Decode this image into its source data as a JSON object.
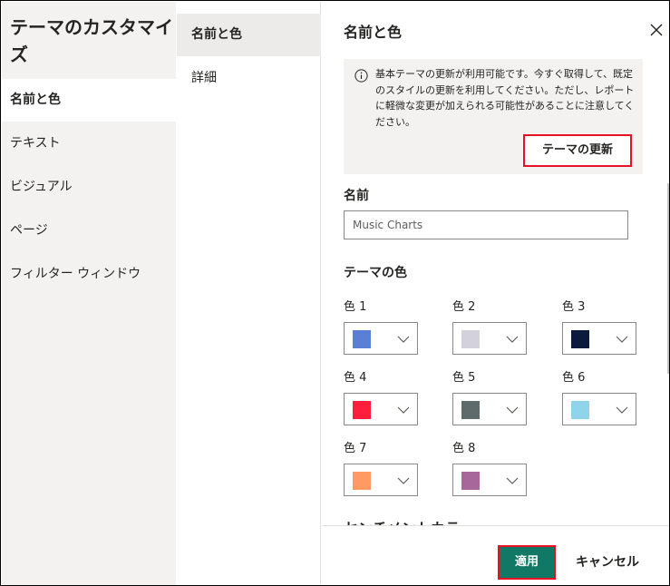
{
  "left_nav": {
    "title": "テーマのカスタマイズ",
    "items": [
      {
        "label": "名前と色"
      },
      {
        "label": "テキスト"
      },
      {
        "label": "ビジュアル"
      },
      {
        "label": "ページ"
      },
      {
        "label": "フィルター ウィンドウ"
      }
    ]
  },
  "sub_nav": {
    "items": [
      {
        "label": "名前と色"
      },
      {
        "label": "詳細"
      }
    ]
  },
  "main": {
    "section_title": "名前と色",
    "notice": {
      "icon": "info-icon",
      "message": "基本テーマの更新が利用可能です。今すぐ取得して、既定のスタイルの更新を利用してください。ただし、レポートに軽微な変更が加えられる可能性があることに注意してください。",
      "update_button": "テーマの更新"
    },
    "name_label": "名前",
    "name_value": "Music Charts",
    "theme_colors_title": "テーマの色",
    "colors": [
      {
        "label": "色 1",
        "hex": "#5b7fd6"
      },
      {
        "label": "色 2",
        "hex": "#d2d1dc"
      },
      {
        "label": "色 3",
        "hex": "#0b1a3c"
      },
      {
        "label": "色 4",
        "hex": "#ff1f3d"
      },
      {
        "label": "色 5",
        "hex": "#5f6b6b"
      },
      {
        "label": "色 6",
        "hex": "#8fd4ea"
      },
      {
        "label": "色 7",
        "hex": "#ff9a63"
      },
      {
        "label": "色 8",
        "hex": "#a8679a"
      }
    ],
    "cutoff_heading": "センチメントカラー"
  },
  "footer": {
    "apply_label": "適用",
    "cancel_label": "キャンセル"
  },
  "colors": {
    "accent": "#117865",
    "highlight_border": "#e81123"
  }
}
